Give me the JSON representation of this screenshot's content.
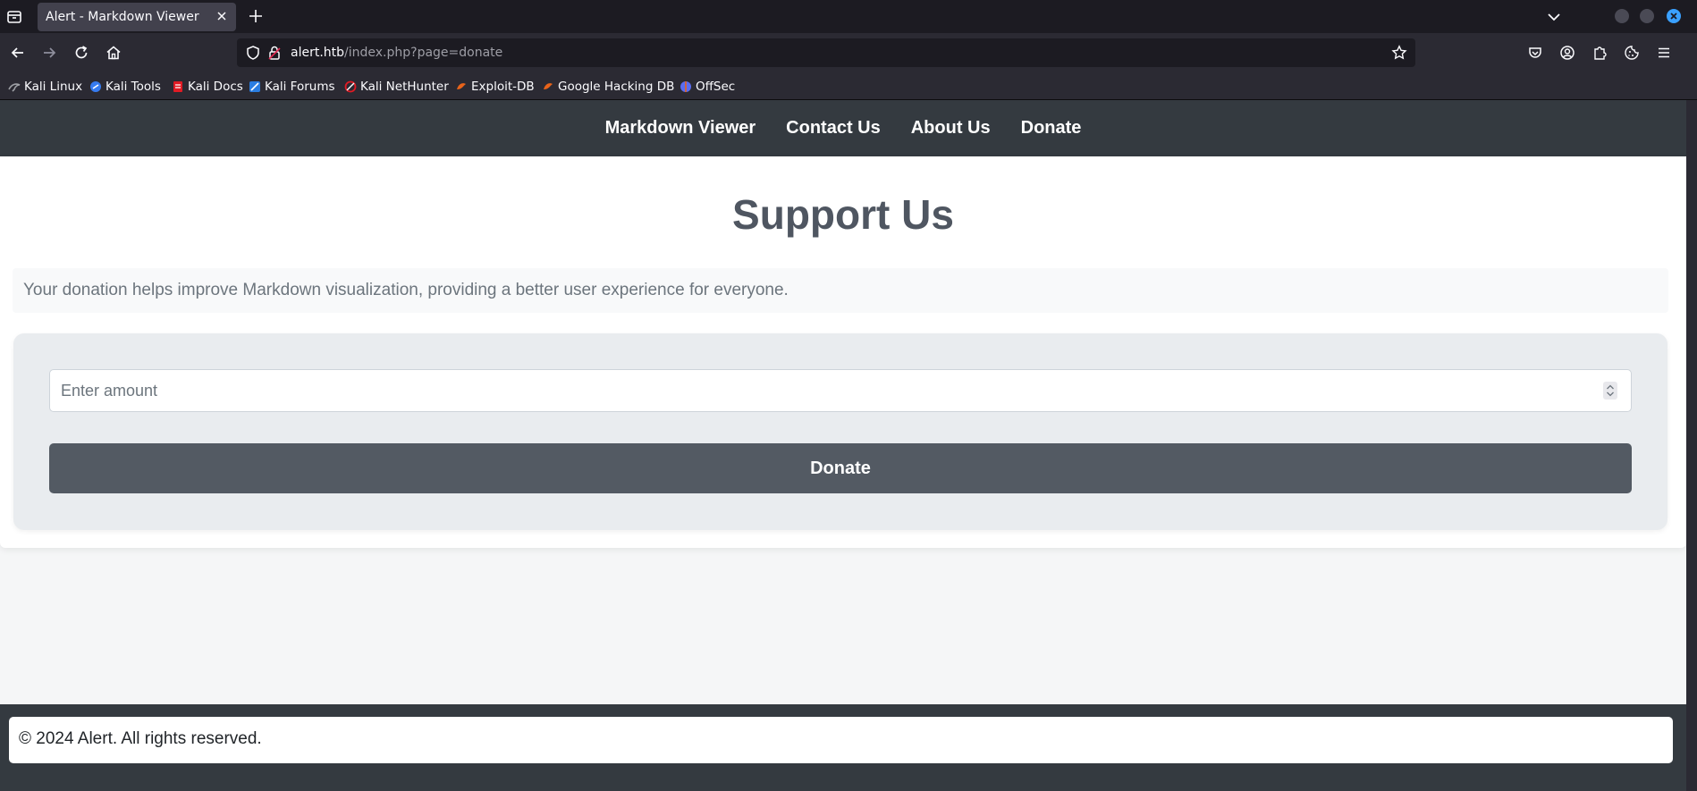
{
  "browser": {
    "tab": {
      "title": "Alert - Markdown Viewer"
    },
    "url": {
      "host": "alert.htb",
      "path": "/index.php?page=donate"
    },
    "bookmarks": [
      {
        "label": "Kali Linux",
        "icon": "kali-dragon-icon",
        "color": "#9ea0a5"
      },
      {
        "label": "Kali Tools",
        "icon": "kali-tools-icon",
        "color": "#367bf0"
      },
      {
        "label": "Kali Docs",
        "icon": "kali-docs-icon",
        "color": "#e01b24"
      },
      {
        "label": "Kali Forums",
        "icon": "kali-forums-icon",
        "color": "#2a7de1"
      },
      {
        "label": "Kali NetHunter",
        "icon": "nethunter-icon",
        "color": "#e01b24"
      },
      {
        "label": "Exploit-DB",
        "icon": "exploit-db-icon",
        "color": "#e8631a"
      },
      {
        "label": "Google Hacking DB",
        "icon": "ghdb-icon",
        "color": "#e8631a"
      },
      {
        "label": "OffSec",
        "icon": "offsec-icon",
        "color": "#5a6cf0"
      }
    ]
  },
  "site": {
    "nav": {
      "links": [
        "Markdown Viewer",
        "Contact Us",
        "About Us",
        "Donate"
      ]
    },
    "heading": "Support Us",
    "intro": "Your donation helps improve Markdown visualization, providing a better user experience for everyone.",
    "form": {
      "amount_placeholder": "Enter amount",
      "amount_value": "",
      "submit_label": "Donate"
    },
    "footer": "© 2024 Alert. All rights reserved."
  },
  "colors": {
    "nav_bg": "#343a40",
    "button_bg": "#535a63",
    "heading": "#4f5661",
    "muted_text": "#6c757d",
    "card_bg": "#e9ecef"
  }
}
